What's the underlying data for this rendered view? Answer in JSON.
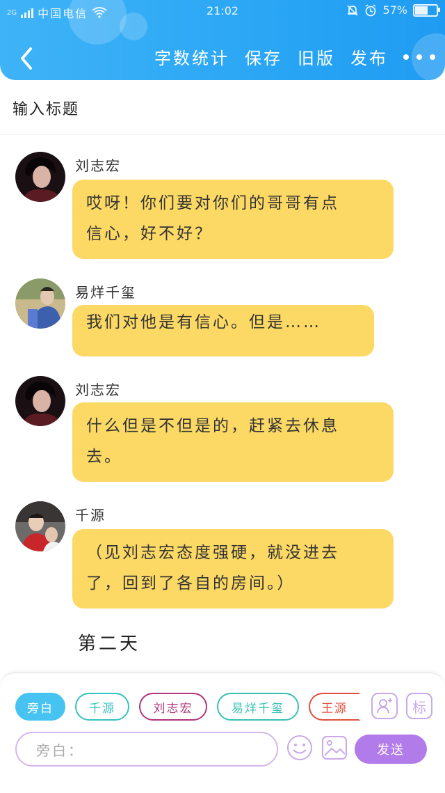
{
  "status_bar": {
    "network": "2G",
    "carrier": "中国电信",
    "time": "21:02",
    "battery": "57%",
    "battery_level": 0.57,
    "icons": [
      "signal-icon",
      "wifi-icon",
      "bell-icon",
      "alarm-icon",
      "battery-icon"
    ]
  },
  "toolbar": {
    "back_icon": "chevron-left-icon",
    "actions": [
      "字数统计",
      "保存",
      "旧版",
      "发布"
    ],
    "more_icon": "more-dots-icon"
  },
  "title_placeholder": "输入标题",
  "messages": [
    {
      "speaker": "刘志宏",
      "lines": [
        "哎呀！你们要对你们的哥哥有点",
        "信心，好不好？"
      ]
    },
    {
      "speaker": "易烊千玺",
      "lines": [
        "我们对他是有信心。但是……"
      ]
    },
    {
      "speaker": "刘志宏",
      "lines": [
        "什么但是不但是的，赶紧去休息",
        "去。"
      ]
    },
    {
      "speaker": "千源",
      "lines": [
        "（见刘志宏态度强硬，就没进去",
        "了，回到了各自的房间。）"
      ]
    }
  ],
  "narration": "第二天",
  "role_chips": [
    {
      "label": "旁白",
      "color": "#46c3f0",
      "active": true
    },
    {
      "label": "千源",
      "color": "#35c2c1",
      "active": false
    },
    {
      "label": "刘志宏",
      "color": "#b0357a",
      "active": false
    },
    {
      "label": "易烊千玺",
      "color": "#35c2b3",
      "active": false
    },
    {
      "label": "王源",
      "color": "#e0503c",
      "active": false
    }
  ],
  "tools": {
    "add_role_icon": "add-role-icon",
    "mark": "标"
  },
  "input": {
    "placeholder": "旁白："
  },
  "emoji_icon": "emoji-icon",
  "image_icon": "image-icon",
  "send_label": "发送",
  "colors": {
    "header": "#2aa6f5",
    "bubble": "#fcd965",
    "accent_purple": "#b27bea"
  }
}
